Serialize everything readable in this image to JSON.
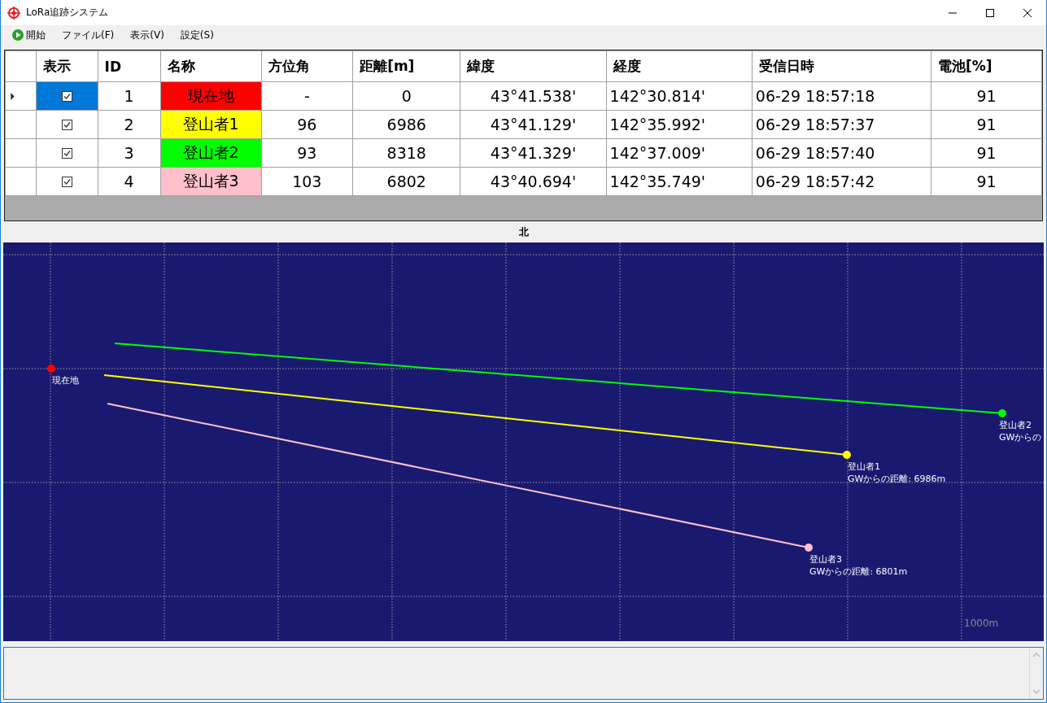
{
  "window": {
    "title": "LoRa追跡システム"
  },
  "menu": [
    {
      "label": "開始",
      "kind": "start"
    },
    {
      "label": "ファイル(F)",
      "kind": "menu"
    },
    {
      "label": "表示(V)",
      "kind": "menu"
    },
    {
      "label": "設定(S)",
      "kind": "menu"
    }
  ],
  "table": {
    "columns": [
      "表示",
      "ID",
      "名称",
      "方位角",
      "距離[m]",
      "緯度",
      "経度",
      "受信日時",
      "電池[%]"
    ],
    "rows": [
      {
        "selected": true,
        "visible": true,
        "id": "1",
        "name": "現在地",
        "color": "#ff0000",
        "bearing": "-",
        "distance": "0",
        "latitude": "43°41.538'",
        "longitude": "142°30.814'",
        "received": "06-29 18:57:18",
        "battery": "91"
      },
      {
        "selected": false,
        "visible": true,
        "id": "2",
        "name": "登山者1",
        "color": "#ffff00",
        "bearing": "96",
        "distance": "6986",
        "latitude": "43°41.129'",
        "longitude": "142°35.992'",
        "received": "06-29 18:57:37",
        "battery": "91"
      },
      {
        "selected": false,
        "visible": true,
        "id": "3",
        "name": "登山者2",
        "color": "#00ff00",
        "bearing": "93",
        "distance": "8318",
        "latitude": "43°41.329'",
        "longitude": "142°37.009'",
        "received": "06-29 18:57:40",
        "battery": "91"
      },
      {
        "selected": false,
        "visible": true,
        "id": "4",
        "name": "登山者3",
        "color": "#ffc0cb",
        "bearing": "103",
        "distance": "6802",
        "latitude": "43°40.694'",
        "longitude": "142°35.749'",
        "received": "06-29 18:57:42",
        "battery": "91"
      }
    ]
  },
  "map": {
    "north_label": "北",
    "scale_label": "1000m",
    "markers": [
      {
        "kind": "origin",
        "color": "#ff0000",
        "name": "現在地"
      },
      {
        "kind": "track",
        "color": "#00ff00",
        "name": "登山者2",
        "distance_label": "GWからの"
      },
      {
        "kind": "track",
        "color": "#ffff00",
        "name": "登山者1",
        "distance_label": "GWからの距離: 6986m"
      },
      {
        "kind": "track",
        "color": "#ffc0cb",
        "name": "登山者3",
        "distance_label": "GWからの距離: 6801m"
      }
    ]
  }
}
